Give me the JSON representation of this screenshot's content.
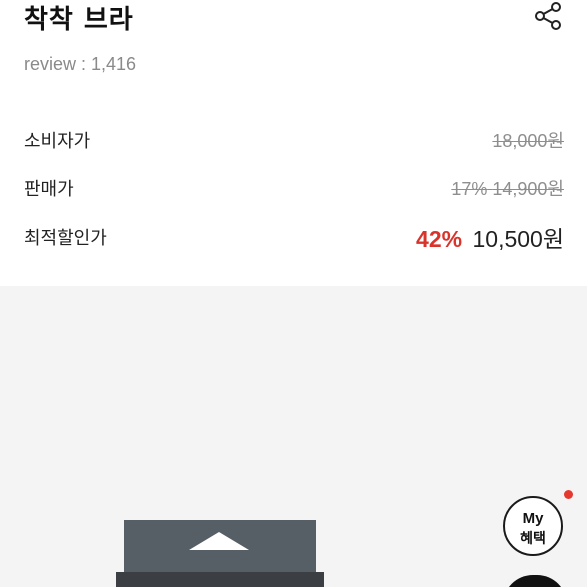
{
  "product": {
    "title": "착착 브라",
    "review_label": "review :",
    "review_count": "1,416"
  },
  "icons": {
    "share": "share-icon"
  },
  "prices": {
    "consumer_label": "소비자가",
    "consumer_price": "18,000원",
    "sale_label": "판매가",
    "sale_discount": "17%",
    "sale_price": "14,900원",
    "best_label": "최적할인가",
    "best_discount": "42%",
    "best_price": "10,500원"
  },
  "benefit_button": {
    "line1": "My",
    "line2": "혜택"
  },
  "colors": {
    "accent_red": "#d8342c",
    "strike_gray": "#8e8e8e",
    "gallery_bg": "#f4f4f4",
    "badge_dot": "#e5392f"
  }
}
